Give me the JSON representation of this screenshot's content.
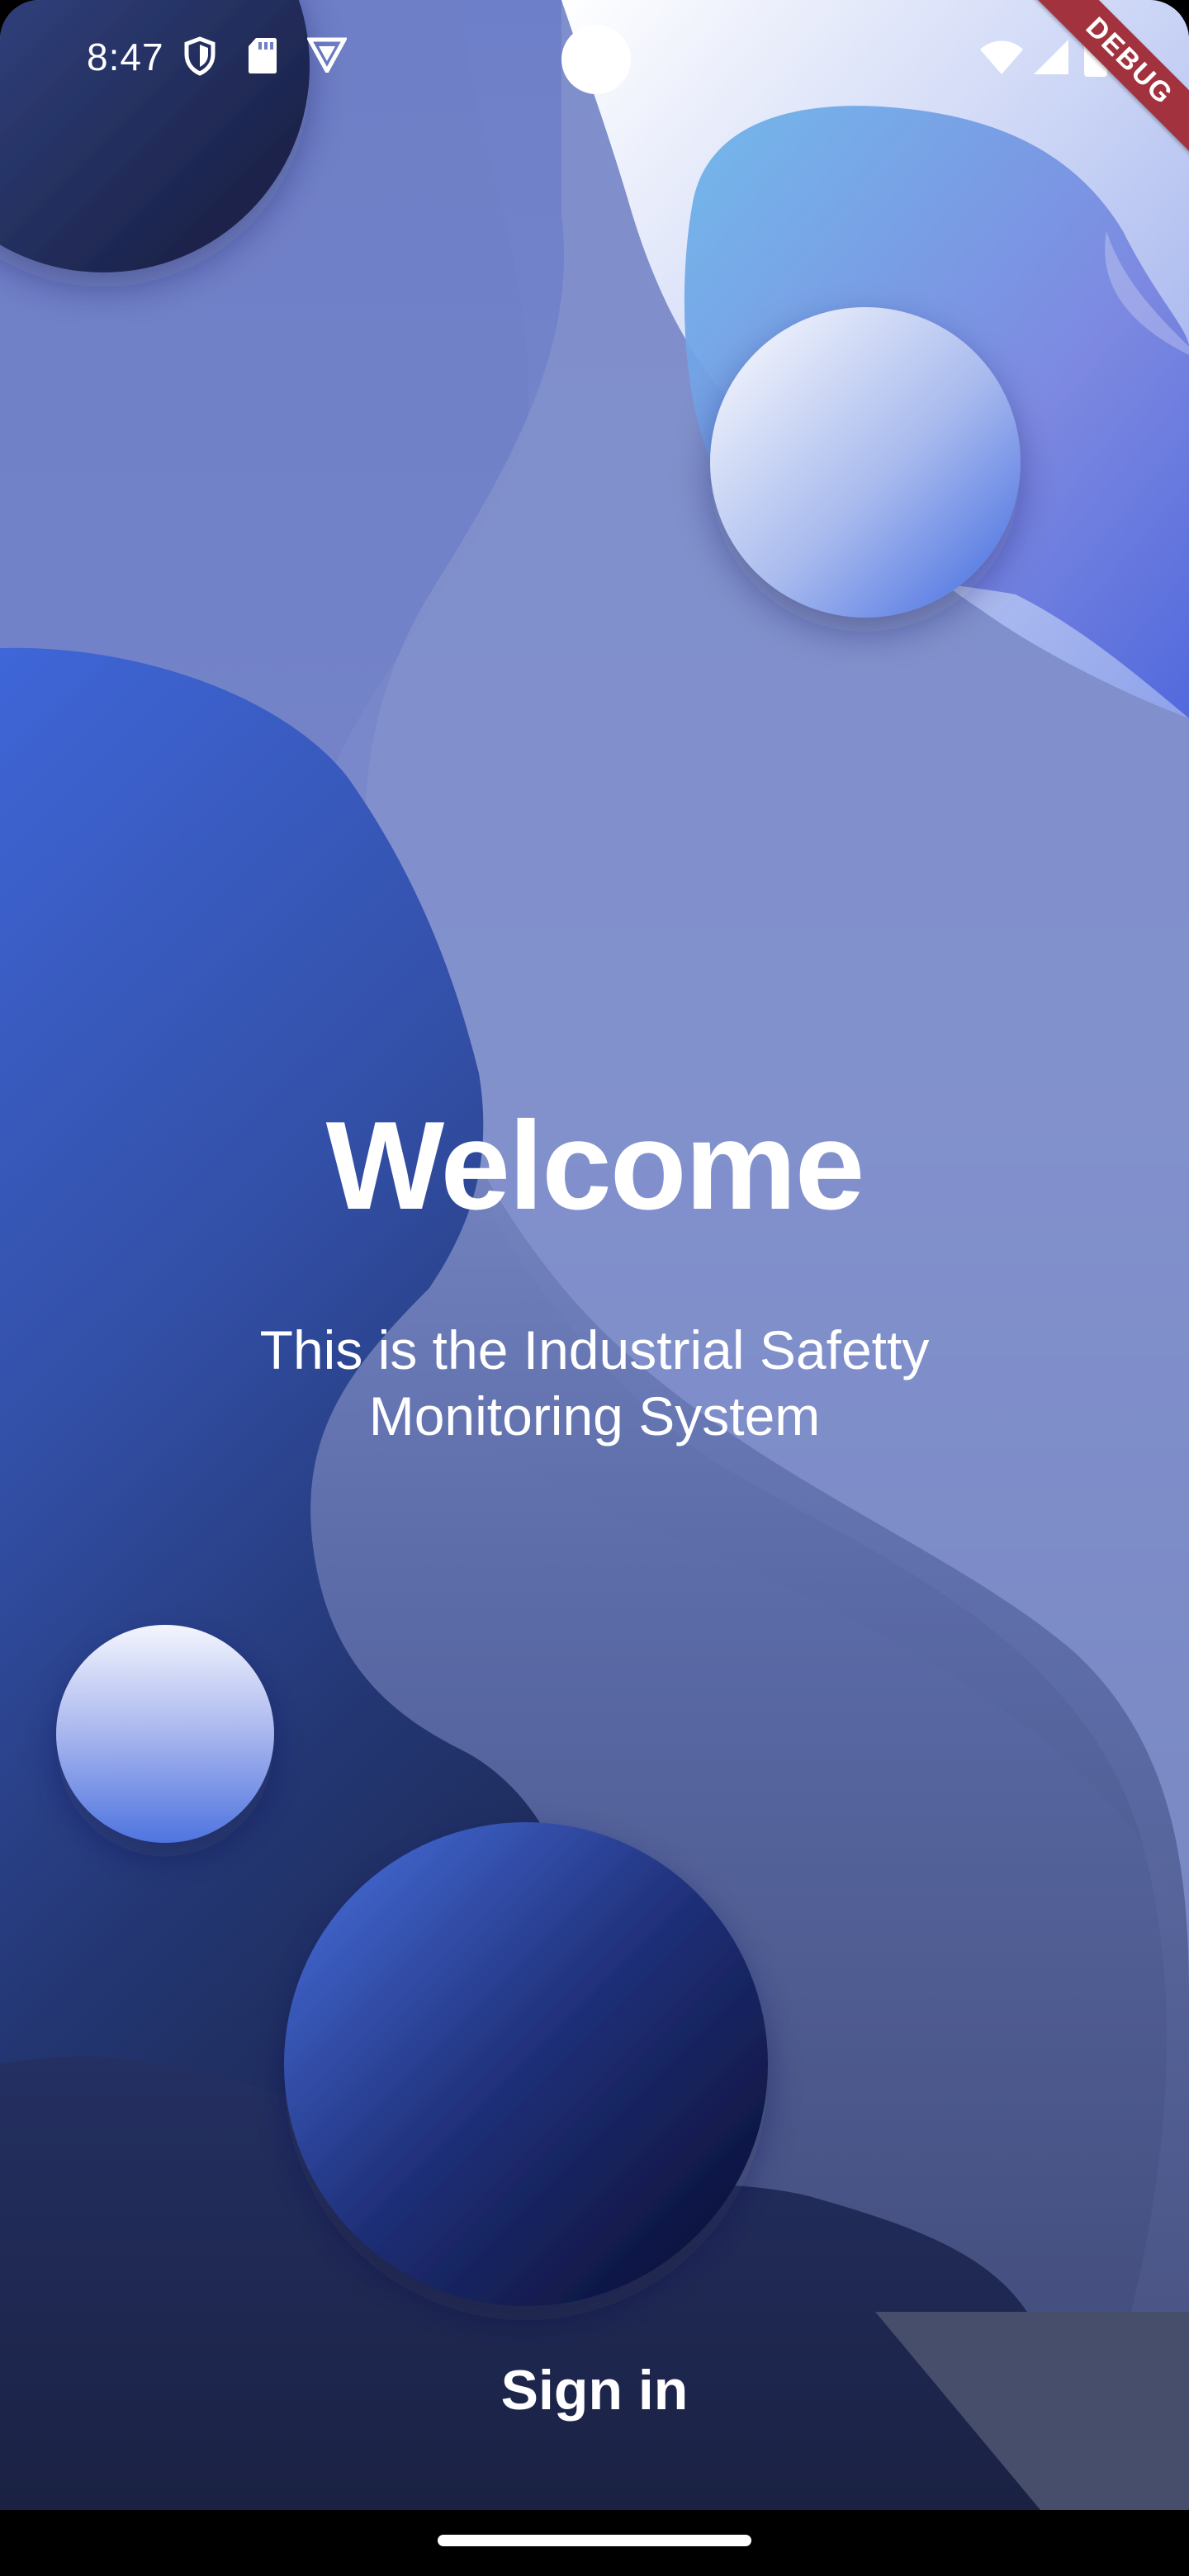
{
  "status_bar": {
    "time": "8:47",
    "left_icons": [
      "shield-icon",
      "sd-card-icon",
      "vpn-badge-icon"
    ],
    "right_icons": [
      "wifi-icon",
      "cellular-signal-icon",
      "battery-icon"
    ],
    "debug_banner": "DEBUG"
  },
  "welcome": {
    "title": "Welcome",
    "subtitle": "This is the Industrial Safetty Monitoring System"
  },
  "actions": {
    "sign_in_label": "Sign in"
  },
  "colors": {
    "primary_blue": "#3f66d8",
    "deep_navy": "#1b2448",
    "debug_red": "#a1323e",
    "text": "#ffffff"
  }
}
